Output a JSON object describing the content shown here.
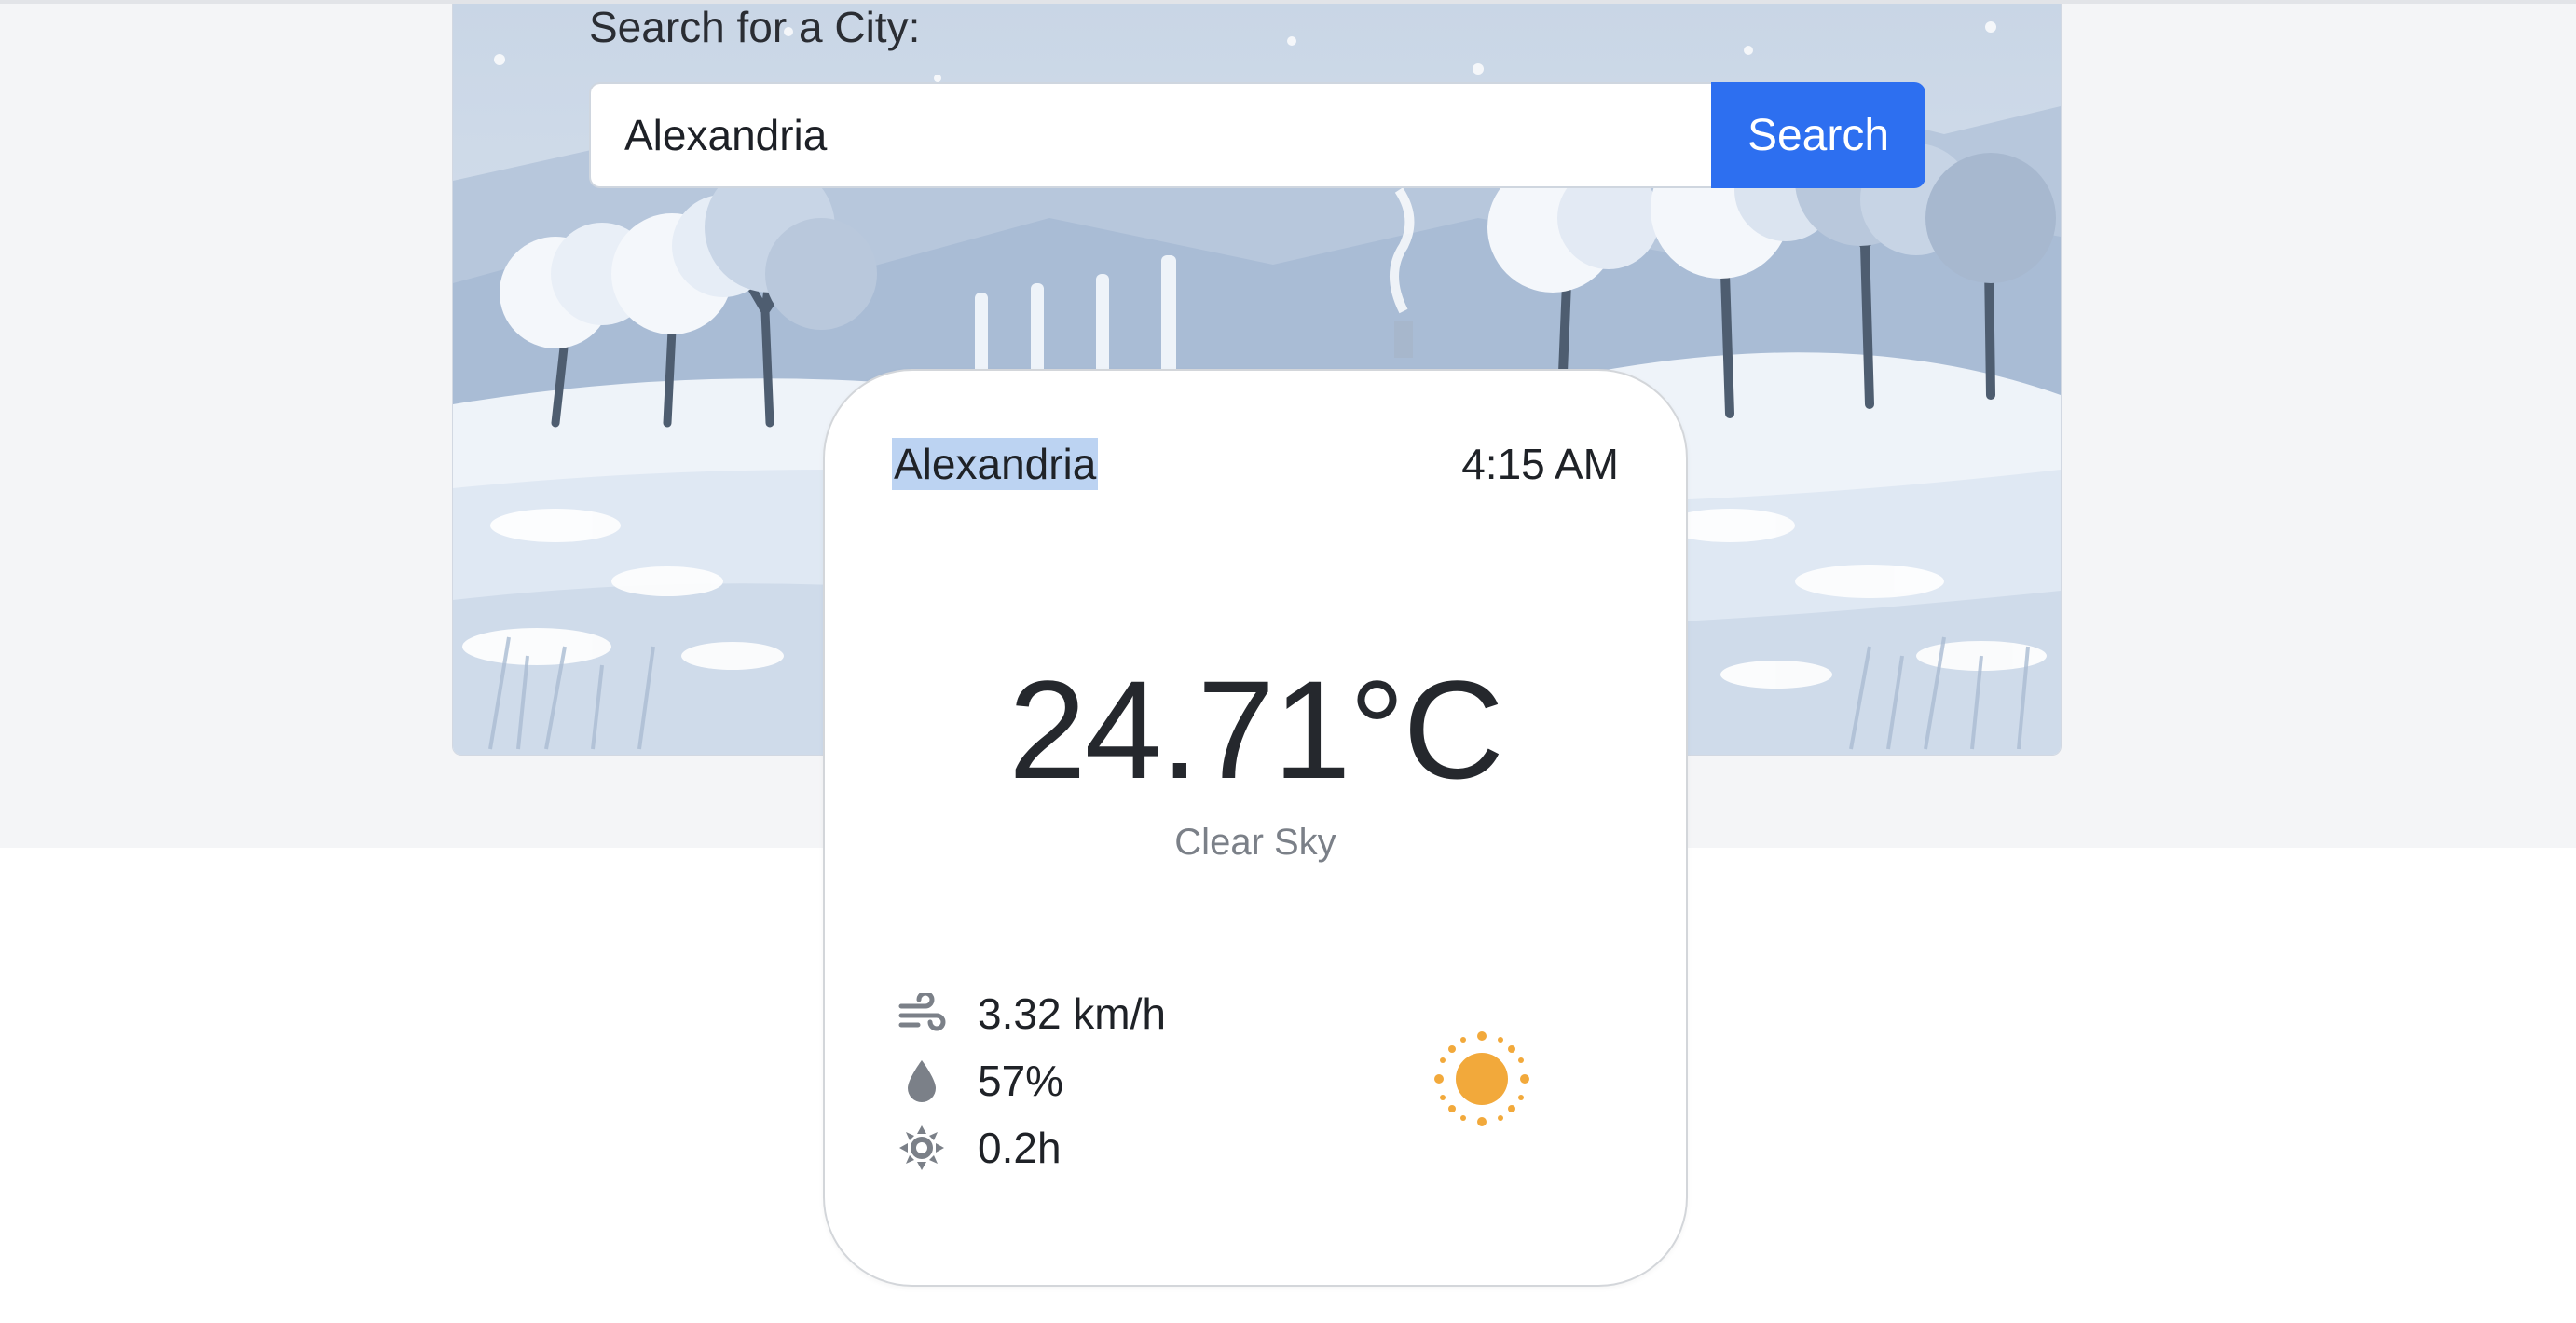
{
  "search": {
    "label": "Search for a City:",
    "input_value": "Alexandria",
    "button_label": "Search"
  },
  "weather": {
    "city": "Alexandria",
    "time": "4:15 AM",
    "temperature": "24.71°C",
    "description": "Clear Sky",
    "wind": "3.32 km/h",
    "humidity": "57%",
    "sunshine": "0.2h",
    "condition_icon": "sun-icon"
  },
  "colors": {
    "accent": "#2d6ff0",
    "sun": "#f2a93b",
    "selection": "#bcd3f2"
  }
}
